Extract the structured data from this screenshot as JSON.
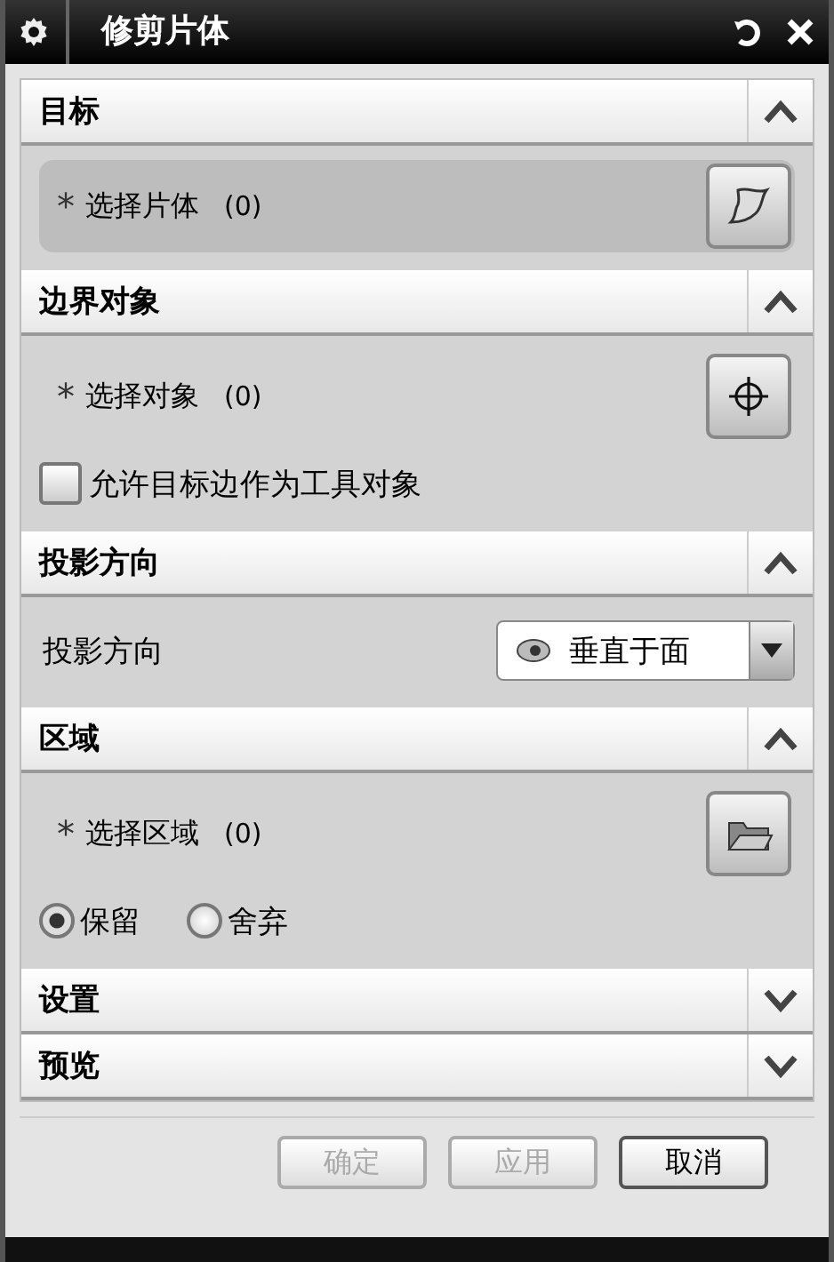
{
  "window": {
    "title": "修剪片体"
  },
  "sections": [
    {
      "title": "目标",
      "expanded": true,
      "rows": [
        {
          "kind": "selection",
          "mark": "*",
          "label": "选择片体",
          "count": "(0)",
          "active": true
        }
      ]
    },
    {
      "title": "边界对象",
      "expanded": true,
      "rows": [
        {
          "kind": "selection",
          "mark": "*",
          "label": "选择对象",
          "count": "(0)",
          "active": false
        },
        {
          "kind": "checkbox",
          "label": "允许目标边作为工具对象",
          "checked": false
        }
      ]
    },
    {
      "title": "投影方向",
      "expanded": true,
      "rows": [
        {
          "kind": "dropdown",
          "label": "投影方向",
          "value": "垂直于面"
        }
      ]
    },
    {
      "title": "区域",
      "expanded": true,
      "rows": [
        {
          "kind": "selection",
          "mark": "*",
          "label": "选择区域",
          "count": "(0)",
          "active": false
        },
        {
          "kind": "radio_group",
          "options": [
            {
              "label": "保留",
              "selected": true
            },
            {
              "label": "舍弃",
              "selected": false
            }
          ]
        }
      ]
    },
    {
      "title": "设置",
      "expanded": false
    },
    {
      "title": "预览",
      "expanded": false
    }
  ],
  "buttons": [
    {
      "label": "确定",
      "disabled": true
    },
    {
      "label": "应用",
      "disabled": true
    },
    {
      "label": "取消",
      "disabled": false
    }
  ]
}
